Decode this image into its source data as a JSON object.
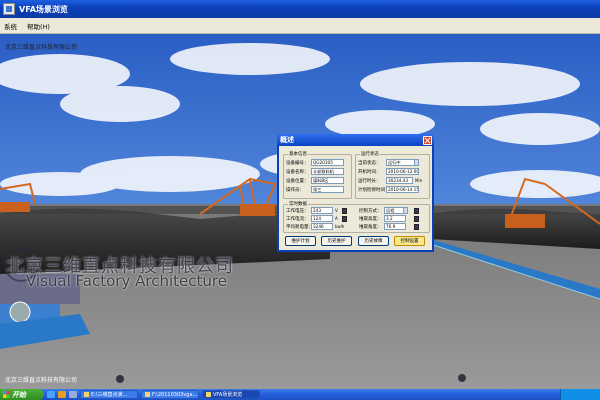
{
  "window": {
    "title": "VFA场景浏览"
  },
  "menu": {
    "items": [
      "系统",
      "帮助(H)"
    ]
  },
  "overlay": {
    "company_top": "北京三维直点科技有限公司",
    "company_bottom": "北京三维直点科技有限公司"
  },
  "watermark": {
    "cn": "北京三维直点科技有限公司",
    "en": "Visual Factory Architecture"
  },
  "dialog": {
    "title": "概述",
    "basic": {
      "title": "基本信息",
      "fields": [
        {
          "label": "设备编号：",
          "value": "QG20105"
        },
        {
          "label": "设备名称：",
          "value": "斗轮取料机"
        },
        {
          "label": "设备位置：",
          "value": "煤料B区"
        },
        {
          "label": "操作员：",
          "value": "张三"
        }
      ]
    },
    "run": {
      "title": "运行状态",
      "fields": [
        {
          "label": "当前状态：",
          "value": "运行中"
        },
        {
          "label": "开机时间：",
          "value": "2010-06-12 00:00"
        },
        {
          "label": "运行时长：",
          "value": "30234.43",
          "unit": "Min"
        },
        {
          "label": "计划检修时间：",
          "value": "2010-06-14 15:00"
        }
      ]
    },
    "realtime": {
      "title": "实时数据",
      "fields": [
        {
          "label": "工作电压：",
          "value": "243",
          "unit": "V"
        },
        {
          "label": "工作电流：",
          "value": "124",
          "unit": "A"
        },
        {
          "label": "平均耗电量：",
          "value": "3246",
          "unit": "kw/h"
        }
      ],
      "control": [
        {
          "label": "控制方式：",
          "value": "远程"
        },
        {
          "label": "堆取高度：",
          "value": "3.2"
        },
        {
          "label": "堆取角度：",
          "value": "76.9"
        }
      ]
    },
    "buttons": [
      "维护计划",
      "历史维护",
      "历史故障",
      "控制设置"
    ]
  },
  "taskbar": {
    "start": "开始",
    "windows": [
      {
        "label": "E:\\三维直点演...",
        "active": false
      },
      {
        "label": "F:\\20110303vga...",
        "active": false
      },
      {
        "label": "VFA场景浏览",
        "active": true
      }
    ]
  },
  "colors": {
    "sky": "#2f66c8",
    "title_bar": "#0a3fb8",
    "crane": "#d2691e",
    "taskbar": "#245edb",
    "start": "#3a9d2b"
  }
}
